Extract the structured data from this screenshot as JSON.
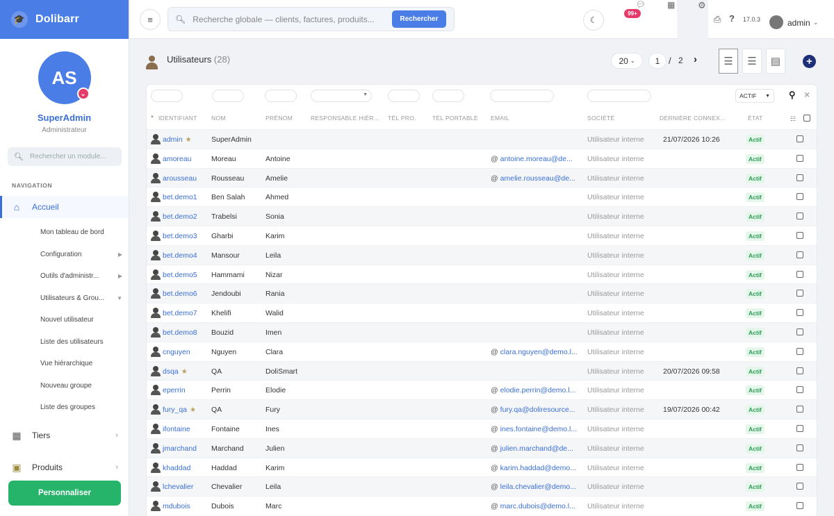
{
  "app": {
    "name": "Dolibarr"
  },
  "profile": {
    "initials": "AS",
    "name": "SuperAdmin",
    "role": "Administrateur"
  },
  "sidebar": {
    "search_placeholder": "Rechercher un module...",
    "nav_heading": "NAVIGATION",
    "accueil": "Accueil",
    "sub_items": [
      {
        "label": "Mon tableau de bord",
        "has_chevron": false
      },
      {
        "label": "Configuration",
        "has_chevron": true,
        "chevron": "▶"
      },
      {
        "label": "Outils d'administr...",
        "has_chevron": true,
        "chevron": "▶"
      },
      {
        "label": "Utilisateurs & Grou...",
        "has_chevron": true,
        "chevron": "▼"
      },
      {
        "label": "Nouvel utilisateur",
        "has_chevron": false
      },
      {
        "label": "Liste des utilisateurs",
        "has_chevron": false
      },
      {
        "label": "Vue hiérarchique",
        "has_chevron": false
      },
      {
        "label": "Nouveau groupe",
        "has_chevron": false
      },
      {
        "label": "Liste des groupes",
        "has_chevron": false
      }
    ],
    "tiers": "Tiers",
    "produits": "Produits",
    "customize_label": "Personnaliser"
  },
  "topbar": {
    "search_placeholder": "Recherche globale — clients, factures, produits...",
    "search_button": "Rechercher",
    "notif_count": "99+",
    "version": "17.0.3",
    "user": "admin"
  },
  "page": {
    "title": "Utilisateurs",
    "count": "(28)",
    "per_page": "20",
    "current_page": "1",
    "page_sep": "/",
    "total_pages": "2"
  },
  "table": {
    "status_filter": "ACTIF",
    "columns": [
      "IDENTIFIANT",
      "NOM",
      "PRÉNOM",
      "RESPONSABLE HIÉR...",
      "TÉL PRO.",
      "TÉL PORTABLE",
      "EMAIL",
      "SOCIÉTÉ",
      "DERNIÈRE CONNEX...",
      "ÉTAT"
    ],
    "rows": [
      {
        "login": "admin",
        "star": true,
        "lastname": "SuperAdmin",
        "firstname": "",
        "email": "",
        "company": "Utilisateur interne",
        "last_login": "21/07/2026 10:26",
        "status": "Actif"
      },
      {
        "login": "amoreau",
        "star": false,
        "lastname": "Moreau",
        "firstname": "Antoine",
        "email": "antoine.moreau@de...",
        "company": "Utilisateur interne",
        "last_login": "",
        "status": "Actif"
      },
      {
        "login": "arousseau",
        "star": false,
        "lastname": "Rousseau",
        "firstname": "Amelie",
        "email": "amelie.rousseau@de...",
        "company": "Utilisateur interne",
        "last_login": "",
        "status": "Actif"
      },
      {
        "login": "bet.demo1",
        "star": false,
        "lastname": "Ben Salah",
        "firstname": "Ahmed",
        "email": "",
        "company": "Utilisateur interne",
        "last_login": "",
        "status": "Actif"
      },
      {
        "login": "bet.demo2",
        "star": false,
        "lastname": "Trabelsi",
        "firstname": "Sonia",
        "email": "",
        "company": "Utilisateur interne",
        "last_login": "",
        "status": "Actif"
      },
      {
        "login": "bet.demo3",
        "star": false,
        "lastname": "Gharbi",
        "firstname": "Karim",
        "email": "",
        "company": "Utilisateur interne",
        "last_login": "",
        "status": "Actif"
      },
      {
        "login": "bet.demo4",
        "star": false,
        "lastname": "Mansour",
        "firstname": "Leila",
        "email": "",
        "company": "Utilisateur interne",
        "last_login": "",
        "status": "Actif"
      },
      {
        "login": "bet.demo5",
        "star": false,
        "lastname": "Hammami",
        "firstname": "Nizar",
        "email": "",
        "company": "Utilisateur interne",
        "last_login": "",
        "status": "Actif"
      },
      {
        "login": "bet.demo6",
        "star": false,
        "lastname": "Jendoubi",
        "firstname": "Rania",
        "email": "",
        "company": "Utilisateur interne",
        "last_login": "",
        "status": "Actif"
      },
      {
        "login": "bet.demo7",
        "star": false,
        "lastname": "Khelifi",
        "firstname": "Walid",
        "email": "",
        "company": "Utilisateur interne",
        "last_login": "",
        "status": "Actif"
      },
      {
        "login": "bet.demo8",
        "star": false,
        "lastname": "Bouzid",
        "firstname": "Imen",
        "email": "",
        "company": "Utilisateur interne",
        "last_login": "",
        "status": "Actif"
      },
      {
        "login": "cnguyen",
        "star": false,
        "lastname": "Nguyen",
        "firstname": "Clara",
        "email": "clara.nguyen@demo.l...",
        "company": "Utilisateur interne",
        "last_login": "",
        "status": "Actif"
      },
      {
        "login": "dsqa",
        "star": true,
        "lastname": "QA",
        "firstname": "DoliSmart",
        "email": "",
        "company": "Utilisateur interne",
        "last_login": "20/07/2026 09:58",
        "status": "Actif"
      },
      {
        "login": "eperrin",
        "star": false,
        "lastname": "Perrin",
        "firstname": "Elodie",
        "email": "elodie.perrin@demo.l...",
        "company": "Utilisateur interne",
        "last_login": "",
        "status": "Actif"
      },
      {
        "login": "fury_qa",
        "star": true,
        "lastname": "QA",
        "firstname": "Fury",
        "email": "fury.qa@doliresource...",
        "company": "Utilisateur interne",
        "last_login": "19/07/2026 00:42",
        "status": "Actif"
      },
      {
        "login": "ifontaine",
        "star": false,
        "lastname": "Fontaine",
        "firstname": "Ines",
        "email": "ines.fontaine@demo.l...",
        "company": "Utilisateur interne",
        "last_login": "",
        "status": "Actif"
      },
      {
        "login": "jmarchand",
        "star": false,
        "lastname": "Marchand",
        "firstname": "Julien",
        "email": "julien.marchand@de...",
        "company": "Utilisateur interne",
        "last_login": "",
        "status": "Actif"
      },
      {
        "login": "khaddad",
        "star": false,
        "lastname": "Haddad",
        "firstname": "Karim",
        "email": "karim.haddad@demo...",
        "company": "Utilisateur interne",
        "last_login": "",
        "status": "Actif"
      },
      {
        "login": "lchevalier",
        "star": false,
        "lastname": "Chevalier",
        "firstname": "Leila",
        "email": "leila.chevalier@demo...",
        "company": "Utilisateur interne",
        "last_login": "",
        "status": "Actif"
      },
      {
        "login": "mdubois",
        "star": false,
        "lastname": "Dubois",
        "firstname": "Marc",
        "email": "marc.dubois@demo.l...",
        "company": "Utilisateur interne",
        "last_login": "",
        "status": "Actif"
      }
    ]
  },
  "colors": {
    "brand": "#4a7ee6",
    "link": "#3a6fd8",
    "success": "#26b36a",
    "badge": "#e53b6a"
  }
}
